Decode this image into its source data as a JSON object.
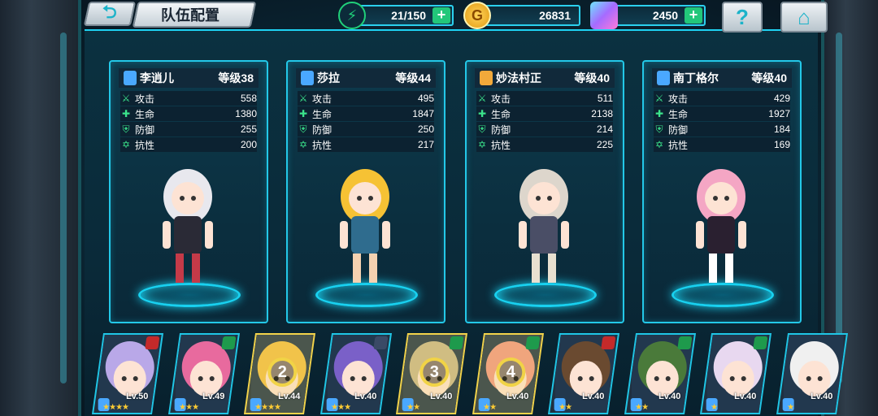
{
  "header": {
    "title": "队伍配置",
    "back_icon": "back-arrow-icon",
    "help_label": "?",
    "home_icon": "home-icon"
  },
  "resources": {
    "stamina": {
      "value": "21/150",
      "icon": "lightning-icon",
      "color": "#20d07a"
    },
    "gold": {
      "value": "26831",
      "icon": "gold-coin-icon",
      "label": "G",
      "color": "#f2b31c"
    },
    "gems": {
      "value": "2450",
      "icon": "crystal-icon",
      "color": "#8f7dff"
    }
  },
  "team": [
    {
      "name": "李逍儿",
      "level": "等级38",
      "attack": "558",
      "hp": "1380",
      "defense": "255",
      "resistance": "200",
      "gem_color": "#4aa8ff"
    },
    {
      "name": "莎拉",
      "level": "等级44",
      "attack": "495",
      "hp": "1847",
      "defense": "250",
      "resistance": "217",
      "gem_color": "#4aa8ff"
    },
    {
      "name": "妙法村正",
      "level": "等级40",
      "attack": "511",
      "hp": "2138",
      "defense": "214",
      "resistance": "225",
      "gem_color": "#f2a93a"
    },
    {
      "name": "南丁格尔",
      "level": "等级40",
      "attack": "429",
      "hp": "1927",
      "defense": "184",
      "resistance": "169",
      "gem_color": "#4aa8ff"
    }
  ],
  "stat_labels": {
    "attack": "攻击",
    "hp": "生命",
    "defense": "防御",
    "resistance": "抗性"
  },
  "roster": [
    {
      "level": "Lv.50",
      "stars": "★★★★",
      "elem": "#c42a2a",
      "hair": "#b9a8e8",
      "selected": false,
      "slot": ""
    },
    {
      "level": "Lv.49",
      "stars": "★★★",
      "elem": "#1e9a4c",
      "hair": "#e86a9e",
      "selected": false,
      "slot": ""
    },
    {
      "level": "Lv.44",
      "stars": "★★★★",
      "elem": "",
      "hair": "#f2c04a",
      "selected": true,
      "slot": "2"
    },
    {
      "level": "Lv.40",
      "stars": "★★★",
      "elem": "#3a4a66",
      "hair": "#7a60c8",
      "selected": false,
      "slot": ""
    },
    {
      "level": "Lv.40",
      "stars": "★★",
      "elem": "#1e9a4c",
      "hair": "#c8b890",
      "selected": true,
      "slot": "3"
    },
    {
      "level": "Lv.40",
      "stars": "★★",
      "elem": "#1e9a4c",
      "hair": "#f09a8a",
      "selected": true,
      "slot": "4"
    },
    {
      "level": "Lv.40",
      "stars": "★★",
      "elem": "#c42a2a",
      "hair": "#6a4a30",
      "selected": false,
      "slot": ""
    },
    {
      "level": "Lv.40",
      "stars": "★★",
      "elem": "#1e9a4c",
      "hair": "#4a7a3a",
      "selected": false,
      "slot": ""
    },
    {
      "level": "Lv.40",
      "stars": "★",
      "elem": "#1e9a4c",
      "hair": "#e8d8f0",
      "selected": false,
      "slot": ""
    },
    {
      "level": "Lv.40",
      "stars": "★",
      "elem": "",
      "hair": "#f0f0f0",
      "selected": false,
      "slot": ""
    }
  ]
}
